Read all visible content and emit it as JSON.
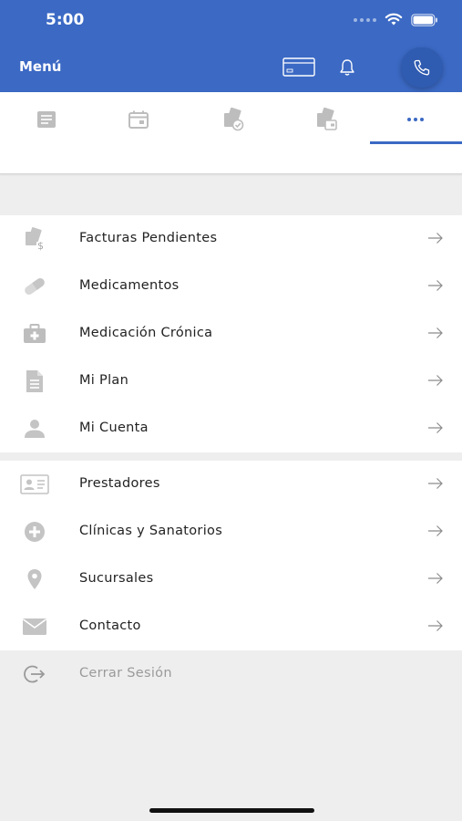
{
  "status_bar": {
    "time": "5:00"
  },
  "header": {
    "title": "Menú",
    "bg_color": "#3b69c4"
  },
  "tabs": [
    {
      "icon": "document-list-icon"
    },
    {
      "icon": "calendar-icon"
    },
    {
      "icon": "prescription-check-icon"
    },
    {
      "icon": "prescription-wallet-icon"
    },
    {
      "icon": "more-dots-icon",
      "selected": true,
      "label": "•••"
    }
  ],
  "menu_primary": [
    {
      "label": "Facturas Pendientes",
      "icon": "invoice-dollar-icon"
    },
    {
      "label": "Medicamentos",
      "icon": "pill-icon"
    },
    {
      "label": "Medicación Crónica",
      "icon": "medkit-icon"
    },
    {
      "label": "Mi Plan",
      "icon": "document-icon"
    },
    {
      "label": "Mi Cuenta",
      "icon": "person-icon"
    }
  ],
  "menu_secondary": [
    {
      "label": "Prestadores",
      "icon": "id-card-icon"
    },
    {
      "label": "Clínicas y Sanatorios",
      "icon": "plus-circle-icon"
    },
    {
      "label": "Sucursales",
      "icon": "location-pin-icon"
    },
    {
      "label": "Contacto",
      "icon": "envelope-icon"
    }
  ],
  "logout": {
    "label": "Cerrar Sesión",
    "icon": "logout-icon"
  },
  "colors": {
    "accent": "#3b69c4",
    "icon_gray": "#b9b9b9",
    "arrow_gray": "#8c8c8c"
  }
}
